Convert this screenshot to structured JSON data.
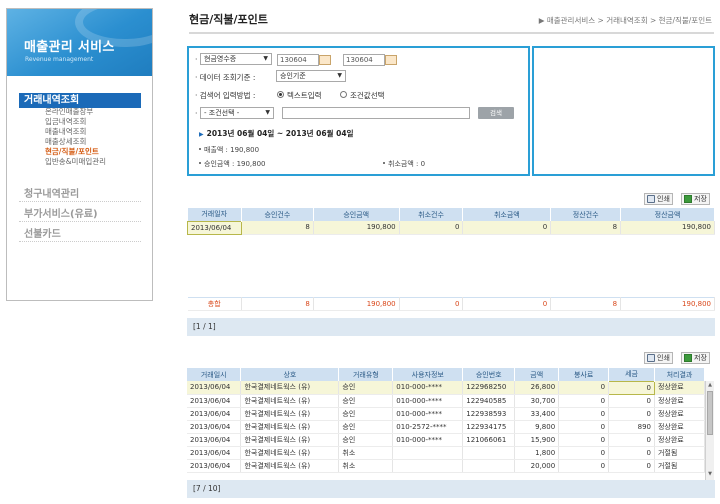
{
  "sidebar": {
    "brand_title": "매출관리 서비스",
    "brand_sub": "Revenue management",
    "active_section": "거래내역조회",
    "sub_items": [
      "온라인매출장부",
      "입금내역조회",
      "매출내역조회",
      "매출상세조회",
      "현금/직불/포인트",
      "입반송&미매입관리"
    ],
    "current_item_index": 4,
    "groups": [
      "청구내역관리",
      "부가서비스(유료)",
      "선불카드"
    ]
  },
  "header": {
    "title": "현금/직불/포인트",
    "breadcrumb": "▶ 매출관리서비스 > 거래내역조회 > 현금/직불/포인트"
  },
  "search": {
    "type_select": "현금영수증",
    "date_from": "130604",
    "date_to": "130604",
    "criteria_label": "데이터 조회기준 :",
    "criteria_select": "승인기준",
    "method_label": "검색어 입력방법 :",
    "radio_text": "텍스트입력",
    "radio_condition": "조건값선택",
    "condition_select": "- 조건선택 -",
    "search_button": "검색",
    "period": "2013년 06월 04일 ~ 2013년 06월 04일",
    "sales_amount": "매출액 : 190,800",
    "approval_amount": "승인금액 : 190,800",
    "cancel_amount": "취소금액 : 0"
  },
  "buttons": {
    "print": "인쇄",
    "save": "저장"
  },
  "summary_table": {
    "columns": [
      "거래일자",
      "승인건수",
      "승인금액",
      "취소건수",
      "취소금액",
      "정산건수",
      "정산금액"
    ],
    "rows": [
      [
        "2013/06/04",
        "8",
        "190,800",
        "0",
        "0",
        "8",
        "190,800"
      ]
    ],
    "total": [
      "총합",
      "8",
      "190,800",
      "0",
      "0",
      "8",
      "190,800"
    ],
    "pager": "[1 / 1]"
  },
  "detail_table": {
    "columns": [
      "거래일시",
      "상호",
      "거래유형",
      "사용자정보",
      "승인번호",
      "금액",
      "봉사료",
      "세금",
      "처리결과"
    ],
    "rows": [
      [
        "2013/06/04",
        "한국결제네트웍스 (유)",
        "승인",
        "010-000-****",
        "122968250",
        "26,800",
        "0",
        "0",
        "정상완료"
      ],
      [
        "2013/06/04",
        "한국결제네트웍스 (유)",
        "승인",
        "010-000-****",
        "122940585",
        "30,700",
        "0",
        "0",
        "정상완료"
      ],
      [
        "2013/06/04",
        "한국결제네트웍스 (유)",
        "승인",
        "010-000-****",
        "122938593",
        "33,400",
        "0",
        "0",
        "정상완료"
      ],
      [
        "2013/06/04",
        "한국결제네트웍스 (유)",
        "승인",
        "010-2572-****",
        "122934175",
        "9,800",
        "0",
        "890",
        "정상완료"
      ],
      [
        "2013/06/04",
        "한국결제네트웍스 (유)",
        "승인",
        "010-000-****",
        "121066061",
        "15,900",
        "0",
        "0",
        "정상완료"
      ],
      [
        "2013/06/04",
        "한국결제네트웍스 (유)",
        "취소",
        "",
        "",
        "1,800",
        "0",
        "0",
        "거절됨"
      ],
      [
        "2013/06/04",
        "한국결제네트웍스 (유)",
        "취소",
        "",
        "",
        "20,000",
        "0",
        "0",
        "거절됨"
      ]
    ],
    "pager": "[7 / 10]"
  }
}
